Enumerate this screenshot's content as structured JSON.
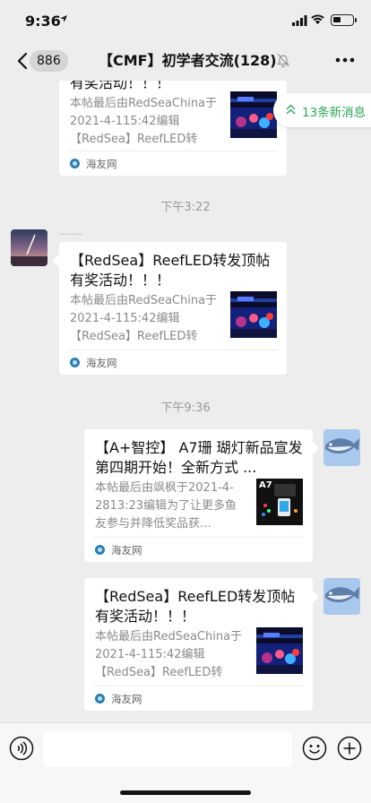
{
  "status": {
    "time": "9:36"
  },
  "nav": {
    "back_count": "886",
    "title": "【CMF】初学者交流(128)"
  },
  "new_messages": {
    "label": "13条新消息"
  },
  "timestamps": [
    "下午3:22",
    "下午9:36"
  ],
  "sender_name": "........",
  "messages": [
    {
      "title_partial": "有奖活动！！！",
      "desc": "本帖最后由RedSeaChina于2021-4-115:42编辑【RedSea】ReefLED转发…",
      "source": "海友网"
    },
    {
      "title": "【RedSea】ReefLED转发顶帖有奖活动！！！",
      "desc": "本帖最后由RedSeaChina于2021-4-115:42编辑【RedSea】ReefLED转发…",
      "source": "海友网"
    },
    {
      "title": "【A+智控】 A7珊 瑚灯新品宣发  第四期开始！全新方式 ...",
      "desc": "本帖最后由飒枫于2021-4-2813:23编辑为了让更多鱼友参与并降低奖品获…",
      "source": "海友网"
    },
    {
      "title": "【RedSea】ReefLED转发顶帖有奖活动！！！",
      "desc": "本帖最后由RedSeaChina于2021-4-115:42编辑【RedSea】ReefLED转发…",
      "source": "海友网"
    }
  ],
  "thumb_labels": {
    "a7": "A7"
  },
  "colors": {
    "background": "#ededed",
    "bubble": "#ffffff",
    "new_msg": "#2aa55a",
    "muted": "#8a8a8a"
  }
}
